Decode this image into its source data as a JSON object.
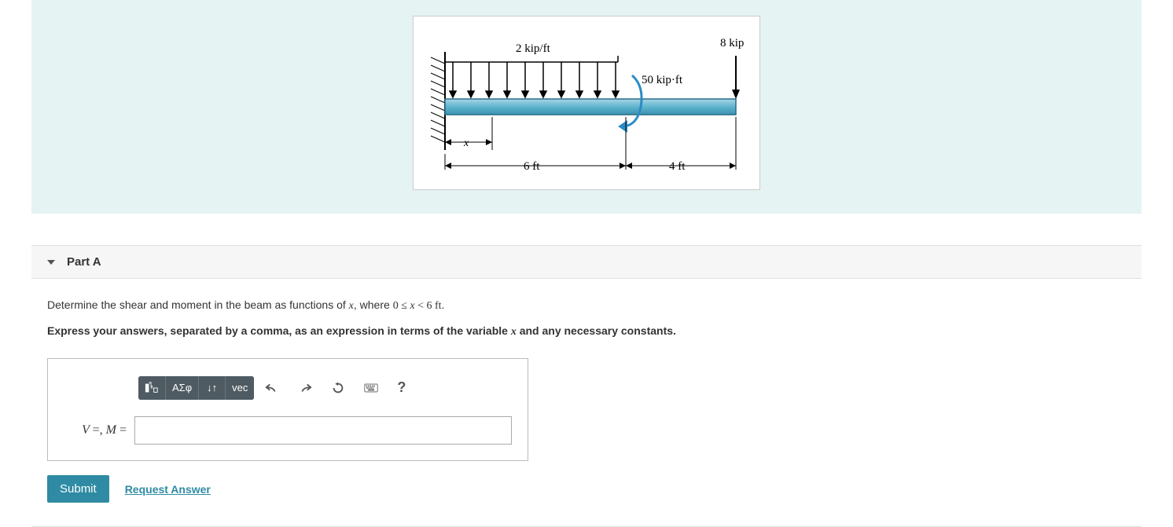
{
  "figure": {
    "distributed_load": "2 kip/ft",
    "point_load": "8 kip",
    "moment": "50 kip·ft",
    "x_label": "x",
    "span_left": "6 ft",
    "span_right": "4 ft"
  },
  "part": {
    "title": "Part A",
    "question_prefix": "Determine the shear and moment in the beam as functions of ",
    "question_var": "x",
    "question_mid": ", where ",
    "question_range": "0 ≤ x < 6 ft",
    "question_suffix": ".",
    "instruction_prefix": "Express your answers, separated by a comma, as an expression in terms of the variable ",
    "instruction_var": "x",
    "instruction_suffix": " and any necessary constants."
  },
  "toolbar": {
    "templates_label": "",
    "greek_label": "ΑΣφ",
    "subscript_label": "↓↑",
    "vec_label": "vec",
    "help_label": "?"
  },
  "input": {
    "label": "V =, M =",
    "value": ""
  },
  "actions": {
    "submit": "Submit",
    "request": "Request Answer"
  }
}
